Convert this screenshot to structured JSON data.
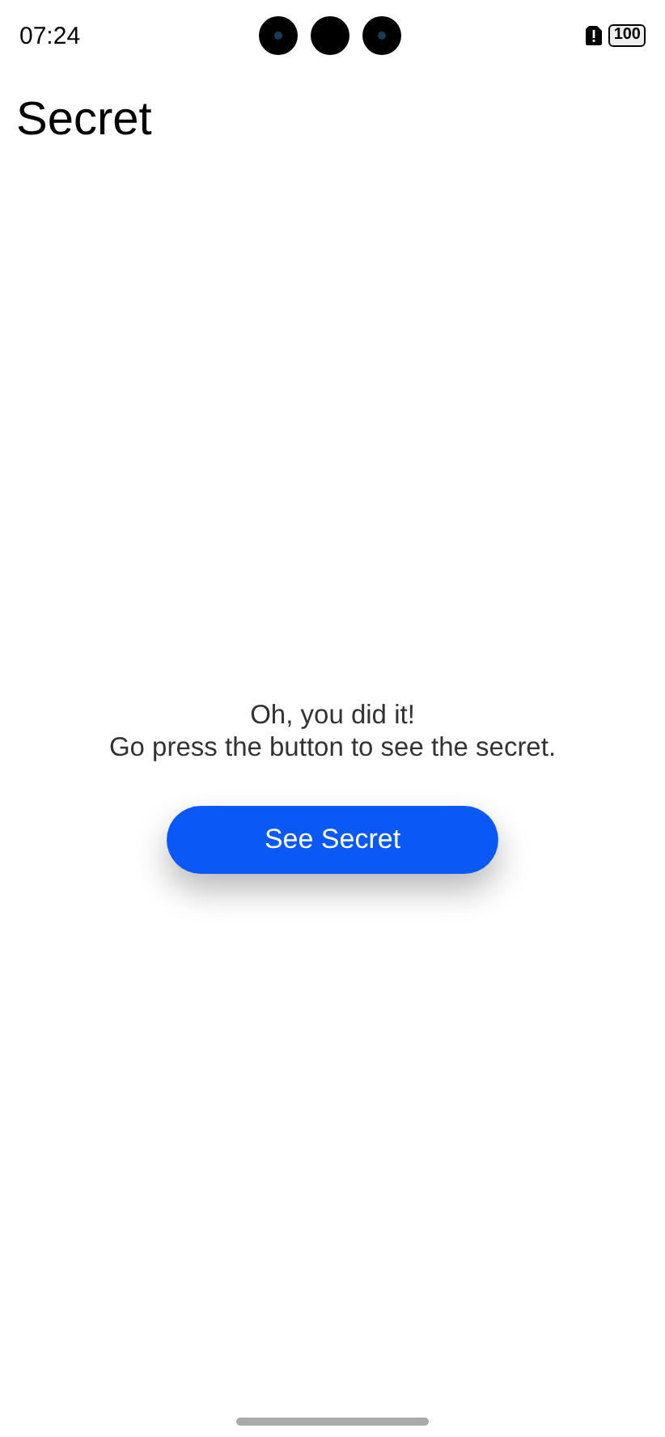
{
  "status_bar": {
    "time": "07:24",
    "battery": "100"
  },
  "header": {
    "title": "Secret"
  },
  "message": {
    "lines": [
      "Oh, you did it!",
      "Go press the button to see the secret."
    ]
  },
  "button": {
    "label": "See Secret"
  }
}
